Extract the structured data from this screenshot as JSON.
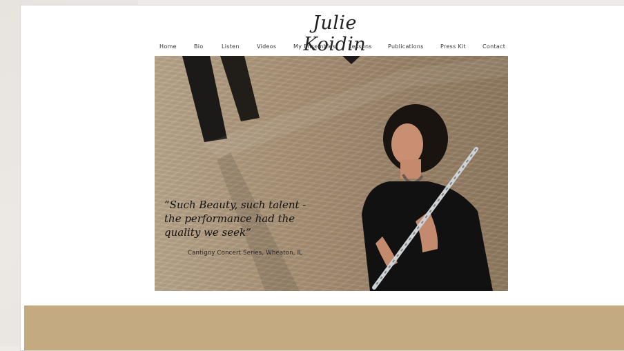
{
  "logo": {
    "text": "Julie Koidin"
  },
  "nav": {
    "items": [
      {
        "label": "Home"
      },
      {
        "label": "Bio"
      },
      {
        "label": "Listen"
      },
      {
        "label": "Videos"
      },
      {
        "label": "My Ensembles"
      },
      {
        "label": "Lessons"
      },
      {
        "label": "Publications"
      },
      {
        "label": "Press Kit"
      },
      {
        "label": "Contact"
      }
    ]
  },
  "hero": {
    "quote": "“Such Beauty, such talent - the performance had the quality we seek”",
    "quote_source": "Cantigny Concert Series, Wheaton, IL"
  },
  "colors": {
    "accent_band": "#c4aa80",
    "page_bg": "#ffffff",
    "outer_bg": "#eeebe7"
  }
}
